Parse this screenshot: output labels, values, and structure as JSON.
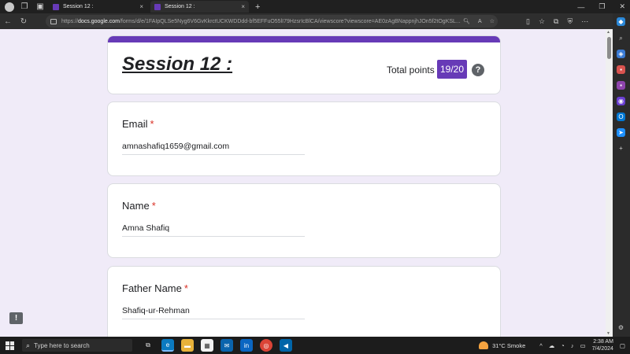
{
  "browser": {
    "tabs": [
      {
        "title": "Session 12 :",
        "close": "×"
      },
      {
        "title": "Session 12 :",
        "close": "×"
      }
    ],
    "new_tab": "+",
    "url_host": "docs.google.com",
    "url_path": "/forms/d/e/1FAIpQLSe5Nyg6V6GvKkrctUCKWDDdd-bf5EFFuO55lI79HzsrIcBlCA/viewscore?viewscore=AE0zAgBNappnjhJOn5f2tOgKSL...",
    "url_prefix": "https://"
  },
  "form": {
    "title": "Session 12 :",
    "points_label": "Total points",
    "points_value": "19/20",
    "help": "?"
  },
  "questions": [
    {
      "label": "Email",
      "required": "*",
      "answer": "amnashafiq1659@gmail.com"
    },
    {
      "label": "Name",
      "required": "*",
      "answer": "Amna Shafiq"
    },
    {
      "label": "Father Name",
      "required": "*",
      "answer": "Shafiq-ur-Rehman"
    }
  ],
  "feedback": "!",
  "taskbar": {
    "search_placeholder": "Type here to search",
    "weather": "31°C  Smoke",
    "time": "2:38 AM",
    "date": "7/4/2024"
  },
  "colors": {
    "accent": "#673ab7",
    "background": "#f0ebf8",
    "required": "#d93025"
  }
}
